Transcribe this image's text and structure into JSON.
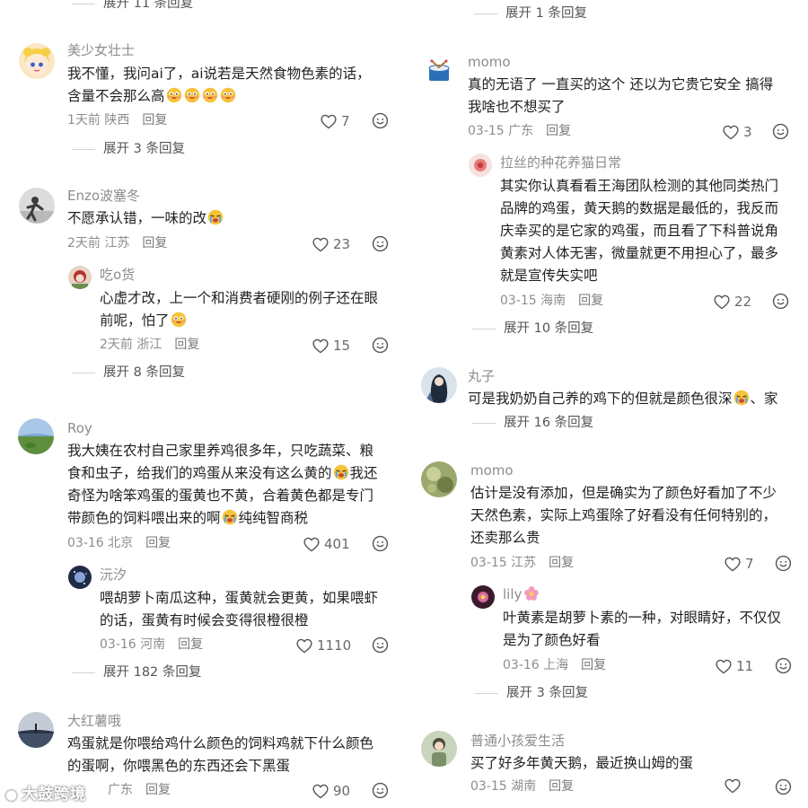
{
  "left": {
    "expand_top": "展开 11 条回复",
    "c1": {
      "name": "美少女壮士",
      "line1": "我不懂，我问ai了，ai说若是天然食物色素的话，",
      "line2": "含量不会那么高",
      "date": "1天前",
      "loc": "陕西",
      "reply": "回复",
      "likes": "7",
      "expand": "展开 3 条回复"
    },
    "c2": {
      "name": "Enzo波塞冬",
      "line1": "不愿承认错，一味的改",
      "date": "2天前",
      "loc": "江苏",
      "reply": "回复",
      "likes": "23"
    },
    "r2": {
      "name": "吃o货",
      "line1": "心虚才改，上一个和消费者硬刚的例子还在眼",
      "line2": "前呢，怕了",
      "date": "2天前",
      "loc": "浙江",
      "reply": "回复",
      "likes": "15",
      "expand": "展开 8 条回复"
    },
    "c3": {
      "name": "Roy",
      "line1": "我大姨在农村自己家里养鸡很多年，只吃蔬菜、粮",
      "line2": "食和虫子，给我们的鸡蛋从来没有这么黄的",
      "line3": "我还",
      "line4": "奇怪为啥笨鸡蛋的蛋黄也不黄，合着黄色都是专门",
      "line5": "带颜色的饲料喂出来的啊",
      "line6": "纯纯智商税",
      "date": "03-16",
      "loc": "北京",
      "reply": "回复",
      "likes": "401"
    },
    "r3": {
      "name": "沅汐",
      "line1": "喂胡萝卜南瓜这种，蛋黄就会更黄，如果喂虾",
      "line2": "的话，蛋黄有时候会变得很橙很橙",
      "date": "03-16",
      "loc": "河南",
      "reply": "回复",
      "likes": "1110",
      "expand": "展开 182 条回复"
    },
    "c4": {
      "name": "大红薯哦",
      "line1": "鸡蛋就是你喂给鸡什么颜色的饲料鸡就下什么颜色",
      "line2": "的蛋啊，你喂黑色的东西还会下黑蛋",
      "loc": "广东",
      "reply": "回复",
      "likes": "90"
    }
  },
  "right": {
    "expand_top": "展开 1 条回复",
    "c1": {
      "name": "momo",
      "line1": "真的无语了 一直买的这个 还以为它贵它安全 搞得",
      "line2": "我啥也不想买了",
      "date": "03-15",
      "loc": "广东",
      "reply": "回复",
      "likes": "3"
    },
    "r1": {
      "name": "拉丝的种花养猫日常",
      "line1": "其实你认真看看王海团队检测的其他同类热门",
      "line2": "品牌的鸡蛋，黄天鹅的数据是最低的，我反而",
      "line3": "庆幸买的是它家的鸡蛋，而且看了下科普说角",
      "line4": "黄素对人体无害，微量就更不用担心了，最多",
      "line5": "就是宣传失实吧",
      "date": "03-15",
      "loc": "海南",
      "reply": "回复",
      "likes": "22",
      "expand": "展开 10 条回复"
    },
    "c2": {
      "name": "丸子",
      "line1": "可是我奶奶自己养的鸡下的但就是颜色很深",
      "line1b": "、家",
      "expand": "展开 16 条回复"
    },
    "c3": {
      "name": "momo",
      "line1": "估计是没有添加，但是确实为了颜色好看加了不少",
      "line2": "天然色素，实际上鸡蛋除了好看没有任何特别的，",
      "line3": "还卖那么贵",
      "date": "03-15",
      "loc": "江苏",
      "reply": "回复",
      "likes": "7"
    },
    "r3": {
      "name": "lily",
      "line1": "叶黄素是胡萝卜素的一种，对眼睛好，不仅仅",
      "line2": "是为了颜色好看",
      "date": "03-16",
      "loc": "上海",
      "reply": "回复",
      "likes": "11",
      "expand": "展开 3 条回复"
    },
    "c4": {
      "name": "普通小孩爱生活",
      "line1": "买了好多年黄天鹅，最近换山姆的蛋",
      "date": "03-15",
      "loc": "湖南",
      "reply": "回复"
    }
  },
  "watermark": "大鼓跨境",
  "colors": {
    "text": "#1f1f1f",
    "meta": "#8d8d8d",
    "heart": "#555555",
    "divider": "#d2d2d2"
  }
}
